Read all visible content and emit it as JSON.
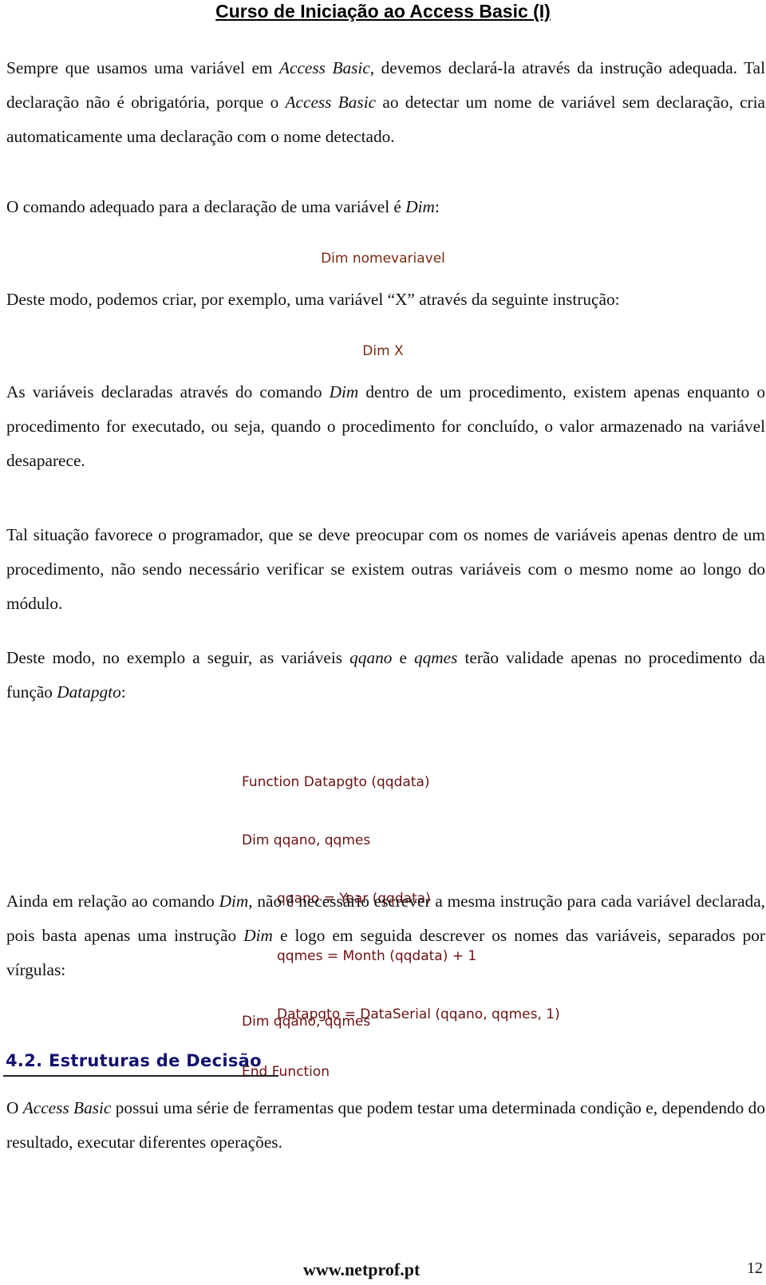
{
  "header": {
    "title": "Curso de Iniciação ao Access Basic (I)"
  },
  "paragraphs": {
    "p1": {
      "a": "Sempre que usamos uma variável em ",
      "b": "Access Basic",
      "c": ", devemos declará-la através da instrução adequada. Tal declaração não é obrigatória, porque o ",
      "d": "Access Basic",
      "e": " ao detectar um nome de variável sem declaração, cria automaticamente uma declaração com o nome detectado."
    },
    "p2": {
      "a": "O comando adequado para a declaração de uma variável é ",
      "b": "Dim",
      "c": ":"
    },
    "p3": {
      "a": "Deste modo, podemos criar, por exemplo, uma variável “X” através da seguinte instrução:"
    },
    "p4": {
      "a": "As variáveis declaradas através do comando ",
      "b": "Dim",
      "c": " dentro de um procedimento, existem apenas enquanto o procedimento for executado, ou seja, quando o procedimento for concluído, o valor armazenado na variável desaparece."
    },
    "p5": {
      "a": "Tal situação favorece o programador, que se deve preocupar com os nomes de variáveis apenas dentro de um procedimento, não sendo necessário verificar se existem outras variáveis com o mesmo nome ao longo do módulo."
    },
    "p6": {
      "a": "Deste modo, no exemplo a seguir, as variáveis ",
      "b": "qqano",
      "c": " e ",
      "d": "qqmes",
      "e": " terão validade apenas no procedimento da função ",
      "f": "Datapgto",
      "g": ":"
    },
    "p7": {
      "a": "Ainda em relação ao comando ",
      "b": "Dim",
      "c": ", não é necessário escrever a mesma instrução para cada variável declarada, pois basta apenas uma instrução ",
      "d": "Dim",
      "e": " e logo em seguida descrever os nomes das variáveis, separados por vírgulas:"
    },
    "p8": {
      "a": "O ",
      "b": "Access Basic",
      "c": " possui uma série de ferramentas que podem testar uma determinada condição e, dependendo do resultado, executar diferentes operações."
    }
  },
  "code": {
    "dim_syntax": "Dim nomevariavel",
    "dim_x": "Dim X",
    "function_block": [
      "Function Datapgto (qqdata)",
      "Dim qqano, qqmes",
      "qqano = Year (qqdata)",
      "qqmes = Month (qqdata) + 1",
      "Datapgto = DataSerial (qqano, qqmes, 1)",
      "End Function"
    ],
    "dim_multi": "Dim qqano, qqmes"
  },
  "section": {
    "heading": "4.2. Estruturas de Decisão"
  },
  "footer": {
    "site": "www.netprof.pt",
    "page_number": "12"
  },
  "colors": {
    "code": "#6b1212",
    "heading": "#12126e",
    "text": "#111111"
  }
}
